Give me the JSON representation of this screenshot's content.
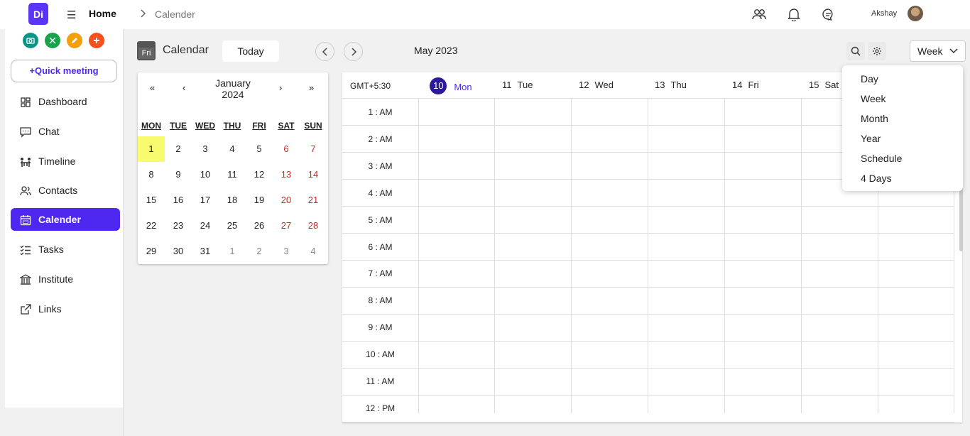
{
  "header": {
    "logo": "Di",
    "home": "Home",
    "breadcrumb": "Calender",
    "user_name": "Akshay"
  },
  "sidebar": {
    "quick_meeting": "+Quick meeting",
    "quick_actions": [
      {
        "icon": "camera-icon",
        "color": "#0d9488"
      },
      {
        "icon": "scissors-icon",
        "color": "#16a34a"
      },
      {
        "icon": "pencil-icon",
        "color": "#f59e0b"
      },
      {
        "icon": "plus-icon",
        "color": "#f4511e"
      }
    ],
    "items": [
      {
        "label": "Dashboard",
        "icon": "dashboard-icon"
      },
      {
        "label": "Chat",
        "icon": "chat-icon"
      },
      {
        "label": "Timeline",
        "icon": "timeline-icon"
      },
      {
        "label": "Contacts",
        "icon": "contacts-icon"
      },
      {
        "label": "Calender",
        "icon": "calendar-icon",
        "active": true
      },
      {
        "label": "Tasks",
        "icon": "tasks-icon"
      },
      {
        "label": "Institute",
        "icon": "institute-icon"
      },
      {
        "label": "Links",
        "icon": "external-link-icon"
      }
    ]
  },
  "toolbar": {
    "calendar_icon_text": "Fri",
    "title": "Calendar",
    "today": "Today",
    "month": "May 2023",
    "view": "Week"
  },
  "mini_calendar": {
    "prev_year": "«",
    "prev_month": "‹",
    "month": "January",
    "year": "2024",
    "next_month": "›",
    "next_year": "»",
    "weekdays": [
      "MON",
      "TUE",
      "WED",
      "THU",
      "FRI",
      "SAT",
      "SUN"
    ],
    "weeks": [
      [
        "1",
        "2",
        "3",
        "4",
        "5",
        "6",
        "7"
      ],
      [
        "8",
        "9",
        "10",
        "11",
        "12",
        "13",
        "14"
      ],
      [
        "15",
        "16",
        "17",
        "18",
        "19",
        "20",
        "21"
      ],
      [
        "22",
        "23",
        "24",
        "25",
        "26",
        "27",
        "28"
      ],
      [
        "29",
        "30",
        "31",
        "1",
        "2",
        "3",
        "4"
      ]
    ],
    "selected": "1"
  },
  "week": {
    "timezone": "GMT+5:30",
    "days": [
      {
        "num": "10",
        "name": "Mon",
        "today": true
      },
      {
        "num": "11",
        "name": "Tue"
      },
      {
        "num": "12",
        "name": "Wed"
      },
      {
        "num": "13",
        "name": "Thu"
      },
      {
        "num": "14",
        "name": "Fri"
      },
      {
        "num": "15",
        "name": "Sat"
      }
    ],
    "hours": [
      "1 : AM",
      "2 : AM",
      "3 : AM",
      "4 : AM",
      "5 : AM",
      "6 : AM",
      "7 : AM",
      "8 : AM",
      "9 : AM",
      "10 : AM",
      "11 : AM",
      "12 : PM"
    ]
  },
  "view_menu": [
    "Day",
    "Week",
    "Month",
    "Year",
    "Schedule",
    "4 Days"
  ]
}
